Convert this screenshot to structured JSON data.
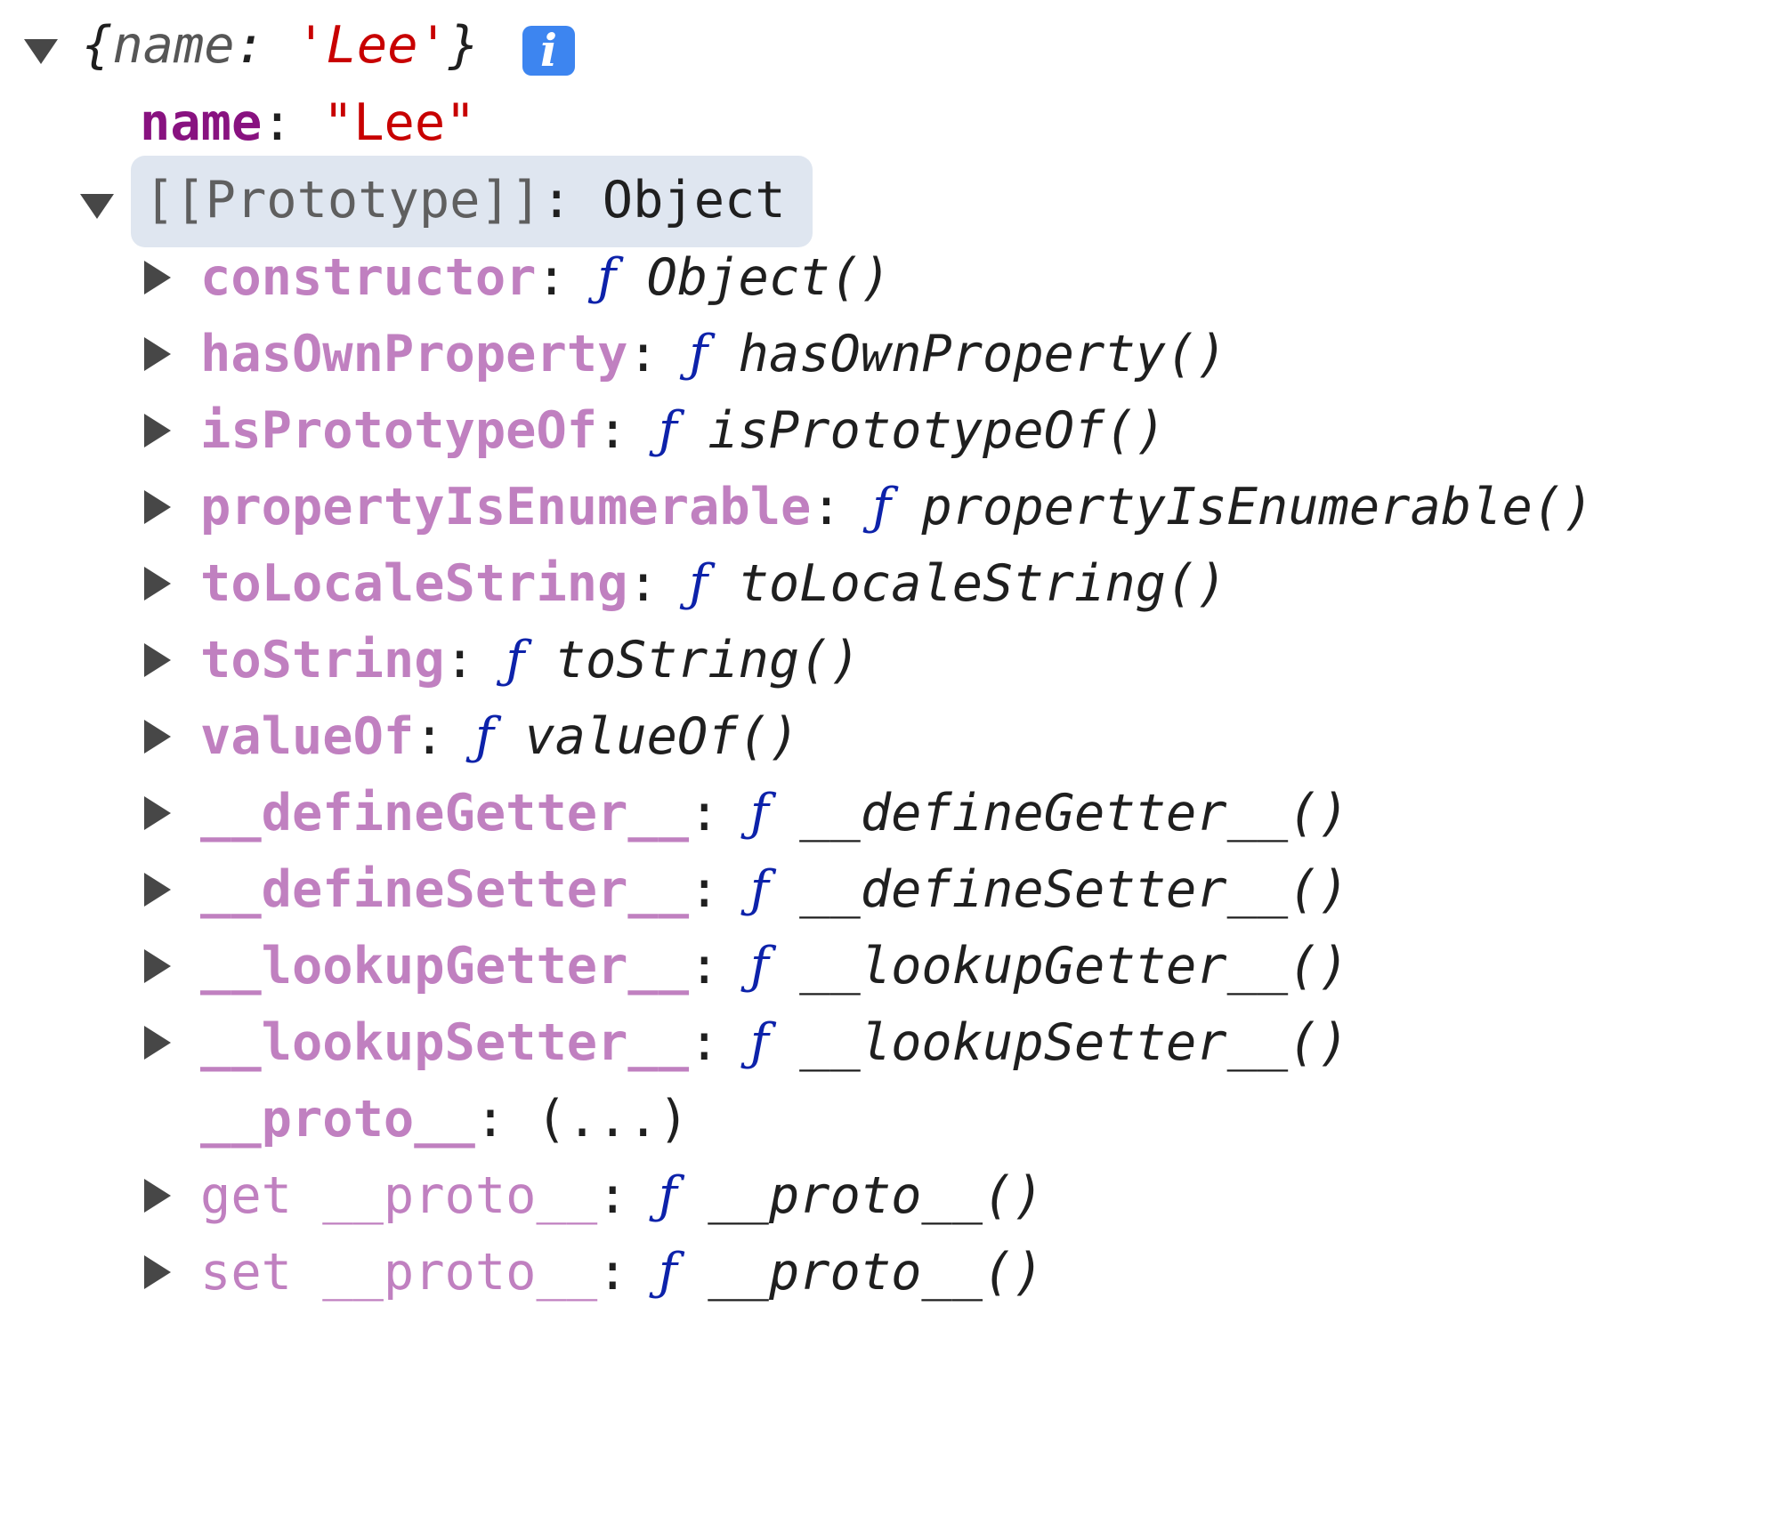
{
  "root": {
    "preview_open": "{",
    "preview_key": "name",
    "preview_sep": ": ",
    "preview_value": "'Lee'",
    "preview_close": "}",
    "info_badge": "i"
  },
  "own_property": {
    "key": "name",
    "sep": ": ",
    "value": "\"Lee\""
  },
  "prototype": {
    "label": "[[Prototype]]",
    "sep": ": ",
    "value": "Object"
  },
  "function_marker": "ƒ",
  "members": [
    {
      "key": "constructor",
      "fn": "Object()"
    },
    {
      "key": "hasOwnProperty",
      "fn": "hasOwnProperty()"
    },
    {
      "key": "isPrototypeOf",
      "fn": "isPrototypeOf()"
    },
    {
      "key": "propertyIsEnumerable",
      "fn": "propertyIsEnumerable()"
    },
    {
      "key": "toLocaleString",
      "fn": "toLocaleString()"
    },
    {
      "key": "toString",
      "fn": "toString()"
    },
    {
      "key": "valueOf",
      "fn": "valueOf()"
    },
    {
      "key": "__defineGetter__",
      "fn": "__defineGetter__()"
    },
    {
      "key": "__defineSetter__",
      "fn": "__defineSetter__()"
    },
    {
      "key": "__lookupGetter__",
      "fn": "__lookupGetter__()"
    },
    {
      "key": "__lookupSetter__",
      "fn": "__lookupSetter__()"
    }
  ],
  "proto_accessor": {
    "key": "__proto__",
    "sep": ": ",
    "value": "(...)"
  },
  "accessors": [
    {
      "prefix": "get",
      "key": "__proto__",
      "fn": "__proto__()"
    },
    {
      "prefix": "set",
      "key": "__proto__",
      "fn": "__proto__()"
    }
  ]
}
